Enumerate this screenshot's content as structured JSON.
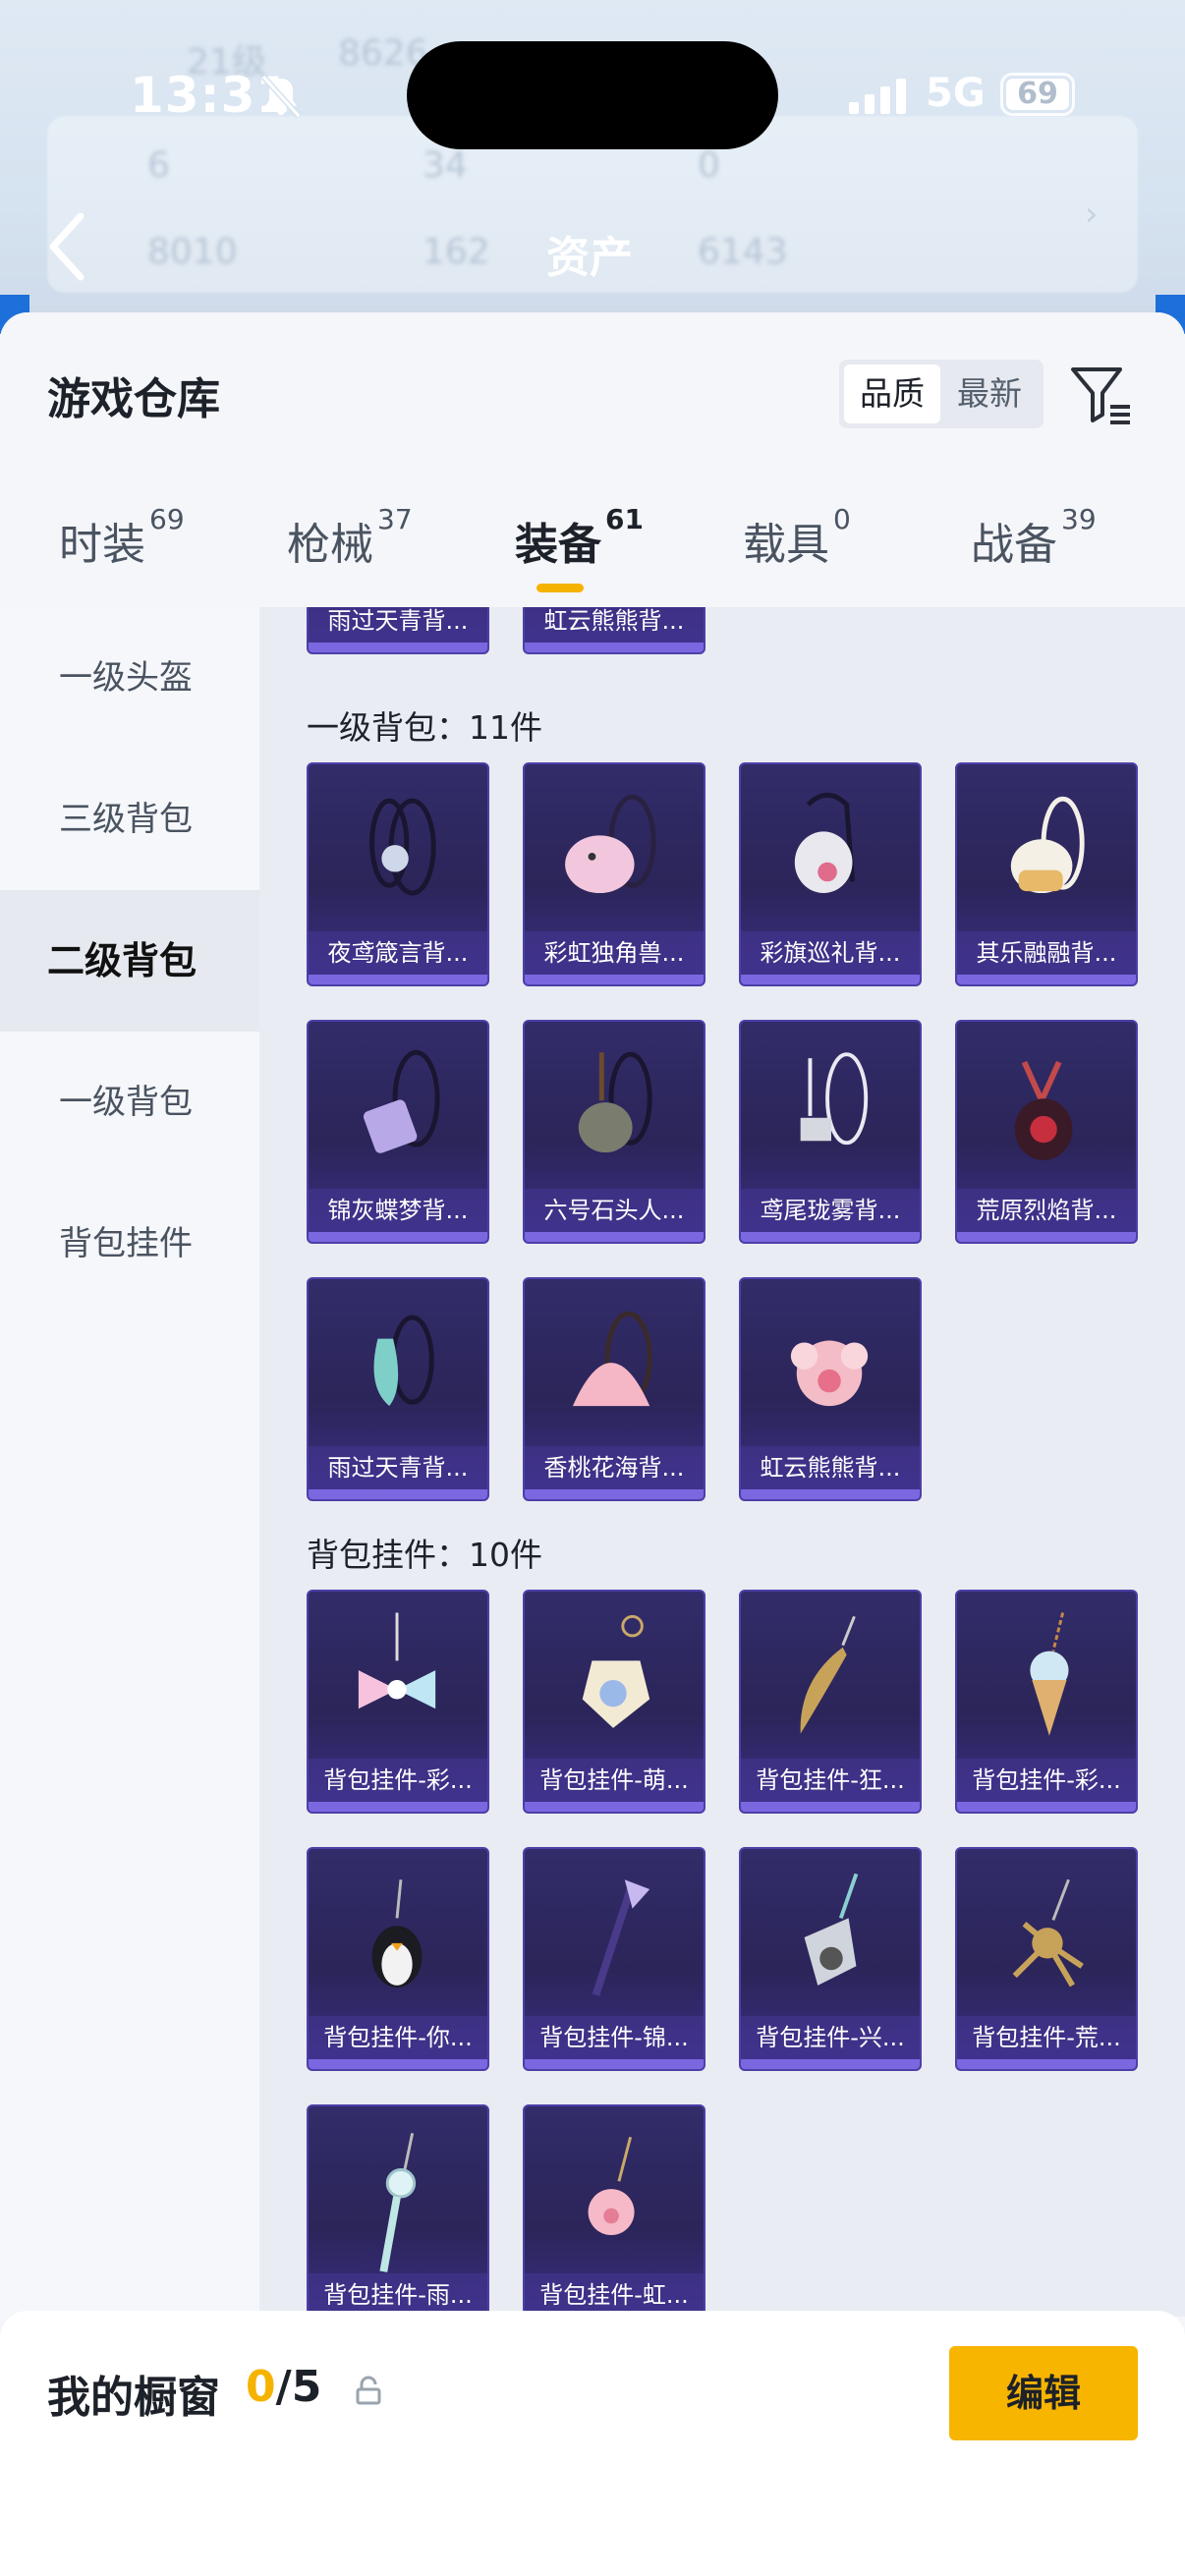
{
  "status_bar": {
    "time": "13:31",
    "network": "5G",
    "battery": "69"
  },
  "background_header": {
    "title": "资产",
    "ghost_text": [
      "21级",
      "8626",
      "6",
      "34",
      "0",
      "8010",
      "162",
      "6143"
    ]
  },
  "panel": {
    "title": "游戏仓库",
    "sort_options": [
      "品质",
      "最新"
    ],
    "tabs": [
      {
        "label": "时装",
        "count": "69"
      },
      {
        "label": "枪械",
        "count": "37"
      },
      {
        "label": "装备",
        "count": "61"
      },
      {
        "label": "载具",
        "count": "0"
      },
      {
        "label": "战备",
        "count": "39"
      }
    ],
    "sidebar": [
      "一级头盔",
      "三级背包",
      "二级背包",
      "一级背包",
      "背包挂件"
    ]
  },
  "content": {
    "top_partial": [
      "雨过天青背...",
      "虹云熊熊背..."
    ],
    "backpack_section": {
      "title": "一级背包：11件",
      "items": [
        "夜鸢箴言背...",
        "彩虹独角兽...",
        "彩旗巡礼背...",
        "其乐融融背...",
        "锦灰蝶梦背...",
        "六号石头人...",
        "鸢尾珑雾背...",
        "荒原烈焰背...",
        "雨过天青背...",
        "香桃花海背...",
        "虹云熊熊背..."
      ]
    },
    "charm_section": {
      "title": "背包挂件：10件",
      "items": [
        "背包挂件-彩...",
        "背包挂件-萌...",
        "背包挂件-狂...",
        "背包挂件-彩...",
        "背包挂件-你...",
        "背包挂件-锦...",
        "背包挂件-兴...",
        "背包挂件-荒...",
        "背包挂件-雨...",
        "背包挂件-虹..."
      ]
    }
  },
  "bottom_bar": {
    "label": "我的橱窗",
    "count_current": "0",
    "count_total": "/5",
    "edit_label": "编辑"
  },
  "colors": {
    "accent": "#f7b500",
    "card_purple": "#2b2559"
  }
}
